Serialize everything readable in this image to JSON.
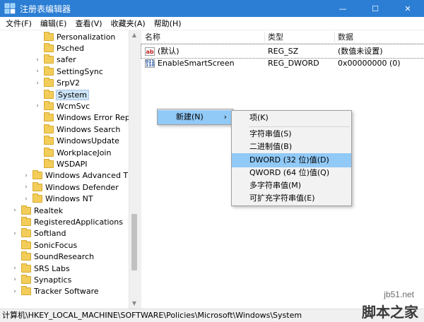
{
  "window": {
    "title": "注册表编辑器",
    "minimize": "—",
    "maximize": "☐",
    "close": "✕"
  },
  "menu": [
    "文件(F)",
    "编辑(E)",
    "查看(V)",
    "收藏夹(A)",
    "帮助(H)"
  ],
  "tree": [
    {
      "label": "Personalization",
      "level": 2,
      "expander": ""
    },
    {
      "label": "Psched",
      "level": 2,
      "expander": ""
    },
    {
      "label": "safer",
      "level": 2,
      "expander": "›"
    },
    {
      "label": "SettingSync",
      "level": 2,
      "expander": "›"
    },
    {
      "label": "SrpV2",
      "level": 2,
      "expander": "›"
    },
    {
      "label": "System",
      "level": 2,
      "expander": "",
      "selected": true
    },
    {
      "label": "WcmSvc",
      "level": 2,
      "expander": "›"
    },
    {
      "label": "Windows Error Repo",
      "level": 2,
      "expander": ""
    },
    {
      "label": "Windows Search",
      "level": 2,
      "expander": ""
    },
    {
      "label": "WindowsUpdate",
      "level": 2,
      "expander": ""
    },
    {
      "label": "WorkplaceJoin",
      "level": 2,
      "expander": ""
    },
    {
      "label": "WSDAPI",
      "level": 2,
      "expander": ""
    },
    {
      "label": "Windows Advanced Thre",
      "level": 1,
      "expander": "›"
    },
    {
      "label": "Windows Defender",
      "level": 1,
      "expander": "›"
    },
    {
      "label": "Windows NT",
      "level": 1,
      "expander": "›"
    },
    {
      "label": "Realtek",
      "level": 0,
      "expander": "›"
    },
    {
      "label": "RegisteredApplications",
      "level": 0,
      "expander": ""
    },
    {
      "label": "Softland",
      "level": 0,
      "expander": "›"
    },
    {
      "label": "SonicFocus",
      "level": 0,
      "expander": ""
    },
    {
      "label": "SoundResearch",
      "level": 0,
      "expander": ""
    },
    {
      "label": "SRS Labs",
      "level": 0,
      "expander": "›"
    },
    {
      "label": "Synaptics",
      "level": 0,
      "expander": "›"
    },
    {
      "label": "Tracker Software",
      "level": 0,
      "expander": "›"
    }
  ],
  "columns": {
    "name": "名称",
    "type": "类型",
    "data": "数据"
  },
  "values": [
    {
      "icon": "ab",
      "name": "(默认)",
      "type": "REG_SZ",
      "data": "(数值未设置)"
    },
    {
      "icon": "bin",
      "name": "EnableSmartScreen",
      "type": "REG_DWORD",
      "data": "0x00000000 (0)"
    }
  ],
  "context_menu": {
    "new_label": "新建(N)",
    "arrow": "›"
  },
  "submenu": [
    {
      "label": "项(K)"
    },
    {
      "label": "字符串值(S)"
    },
    {
      "label": "二进制值(B)"
    },
    {
      "label": "DWORD (32 位)值(D)",
      "highlighted": true
    },
    {
      "label": "QWORD (64 位)值(Q)"
    },
    {
      "label": "多字符串值(M)"
    },
    {
      "label": "可扩充字符串值(E)"
    }
  ],
  "status": "计算机\\HKEY_LOCAL_MACHINE\\SOFTWARE\\Policies\\Microsoft\\Windows\\System",
  "watermark": {
    "url": "jb51.net",
    "name": "脚本之家"
  },
  "colors": {
    "titlebar": "#2b7ed4",
    "highlight": "#91c9f7",
    "folder": "#f3cd5a"
  }
}
